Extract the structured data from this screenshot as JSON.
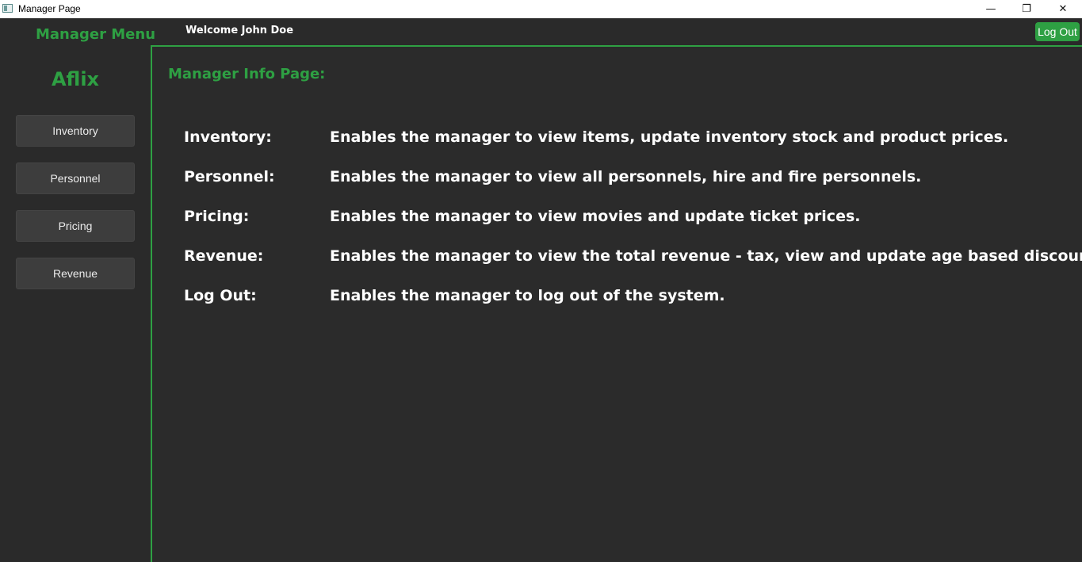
{
  "window": {
    "title": "Manager Page",
    "controls": {
      "minimize": "—",
      "maximize": "❐",
      "close": "✕"
    }
  },
  "header": {
    "menu_title": "Manager Menu",
    "welcome": "Welcome John Doe",
    "logout_label": "Log Out"
  },
  "sidebar": {
    "brand": "Aflix",
    "items": [
      {
        "label": "Inventory"
      },
      {
        "label": "Personnel"
      },
      {
        "label": "Pricing"
      },
      {
        "label": "Revenue"
      }
    ]
  },
  "main": {
    "title": "Manager Info Page:",
    "rows": [
      {
        "label": "Inventory:",
        "description": "Enables the manager to view items, update inventory stock and product prices."
      },
      {
        "label": "Personnel:",
        "description": "Enables the manager to view all personnels, hire and fire personnels."
      },
      {
        "label": "Pricing:",
        "description": "Enables the manager to view movies and update ticket prices."
      },
      {
        "label": "Revenue:",
        "description": "Enables the manager to view the total revenue - tax, view and update age based discounts."
      },
      {
        "label": "Log Out:",
        "description": "Enables the manager to log out of the system."
      }
    ]
  },
  "colors": {
    "accent": "#2ea043",
    "background": "#2a2a2a",
    "button": "#3d3d3d"
  }
}
